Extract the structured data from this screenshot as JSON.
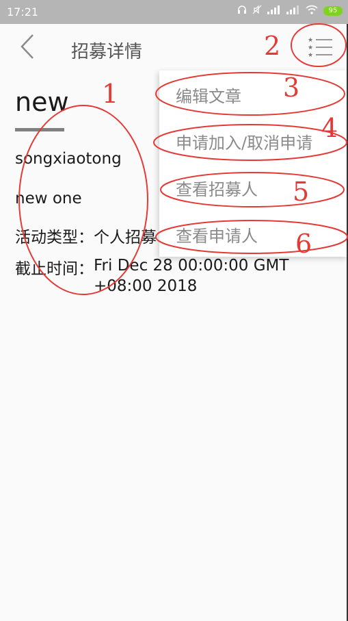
{
  "status_bar": {
    "time": "17:21",
    "battery": "95",
    "icons": [
      "headphones-icon",
      "mute-icon",
      "signal-icon",
      "signal-icon",
      "wifi-icon",
      "battery-icon"
    ]
  },
  "toolbar": {
    "title": "招募详情",
    "back_icon": "chevron-left-icon",
    "menu_icon": "starred-list-icon"
  },
  "article": {
    "title": "new",
    "author": "songxiaotong",
    "body": "new one",
    "type_label": "活动类型：",
    "type_value": "个人招募",
    "deadline_label": "截止时间：",
    "deadline_value": "Fri Dec 28 00:00:00 GMT +08:00 2018"
  },
  "menu": {
    "items": [
      {
        "label": "编辑文章"
      },
      {
        "label": "申请加入/取消申请"
      },
      {
        "label": "查看招募人"
      },
      {
        "label": "查看申请人"
      }
    ]
  },
  "annotations": {
    "color": "#e53935",
    "numbers": [
      "1",
      "2",
      "3",
      "4",
      "5",
      "6"
    ]
  },
  "colors": {
    "status_bar": "#b5b5b5",
    "background": "#fafafa",
    "menu_text": "#8a8a8a",
    "title_underline": "#808080",
    "battery": "#7ed321"
  }
}
